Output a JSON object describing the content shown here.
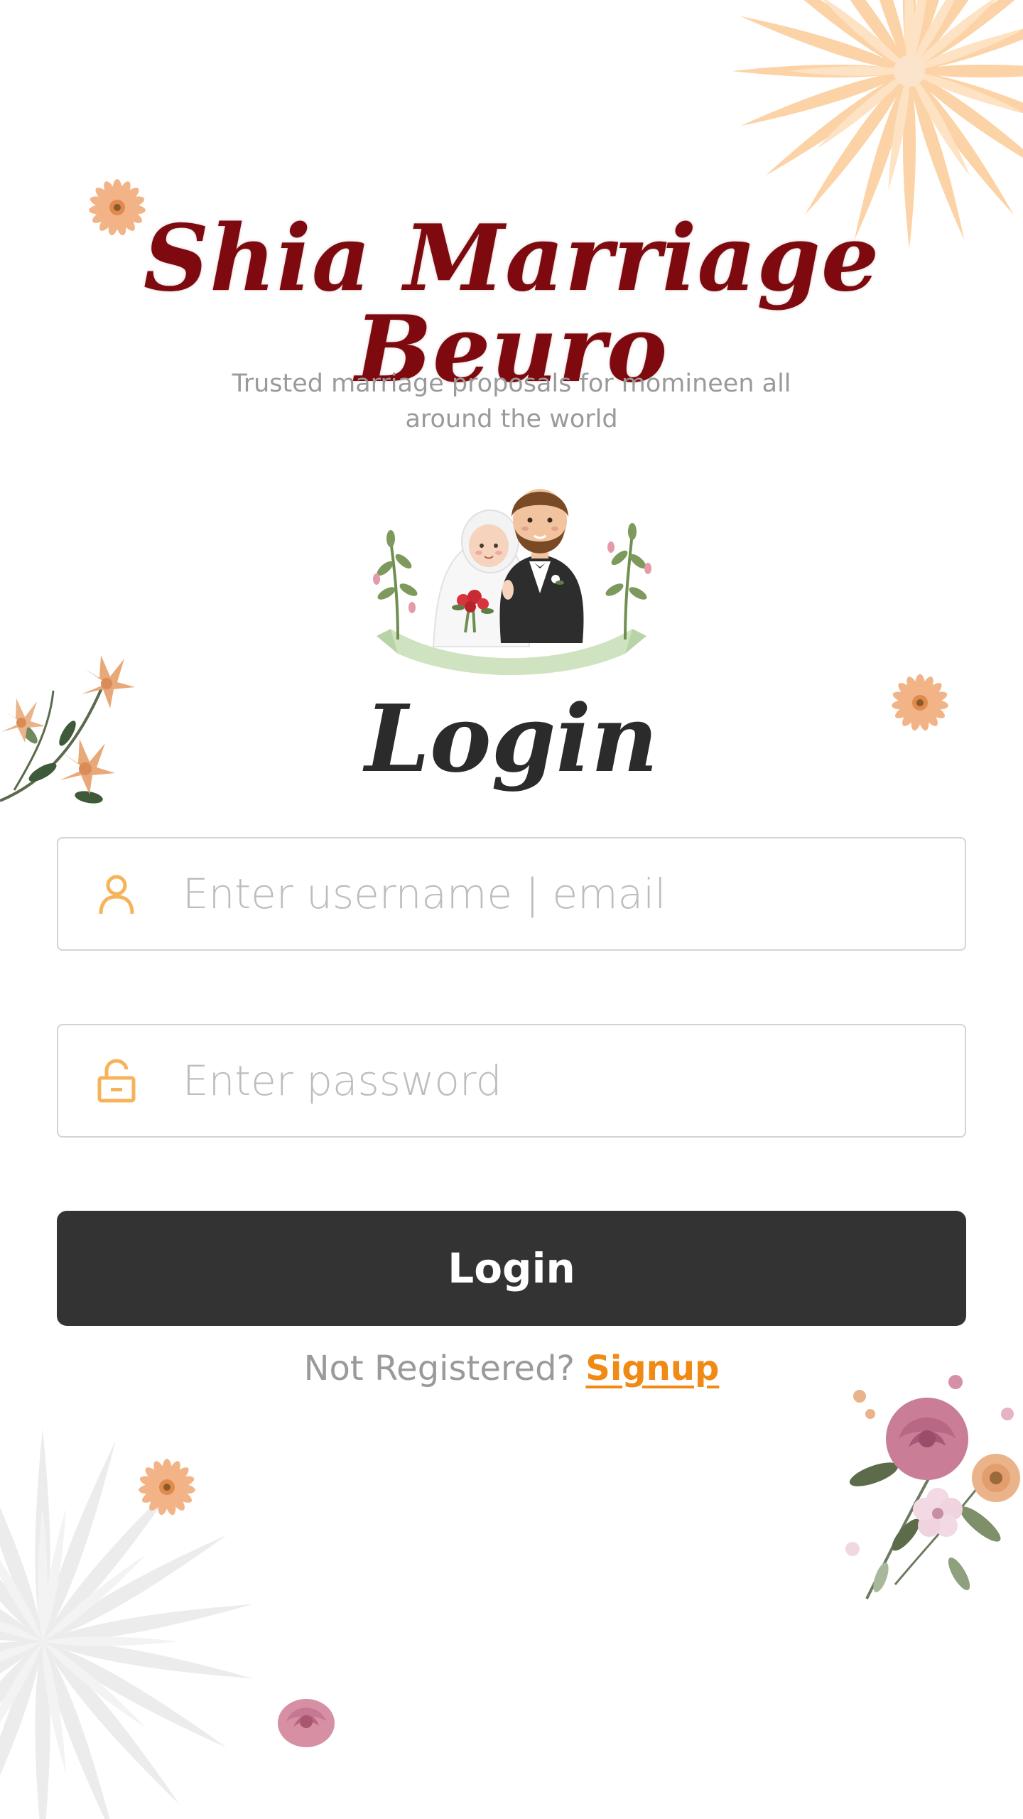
{
  "header": {
    "title": "Shia Marriage Beuro",
    "tagline": "Trusted marriage proposals for momineen all around the world"
  },
  "login": {
    "heading": "Login",
    "username": {
      "placeholder": "Enter username | email",
      "value": "",
      "icon": "user-icon"
    },
    "password": {
      "placeholder": "Enter password",
      "value": "",
      "icon": "unlock-icon"
    },
    "submit_label": "Login",
    "register_prompt": "Not Registered?",
    "signup_link": "Signup"
  },
  "colors": {
    "title": "#7e0a0f",
    "accent": "#f08a14",
    "button": "#333333",
    "icon": "#f7b35a",
    "muted_text": "#9a9a9a",
    "field_border": "#d4d4d4"
  }
}
